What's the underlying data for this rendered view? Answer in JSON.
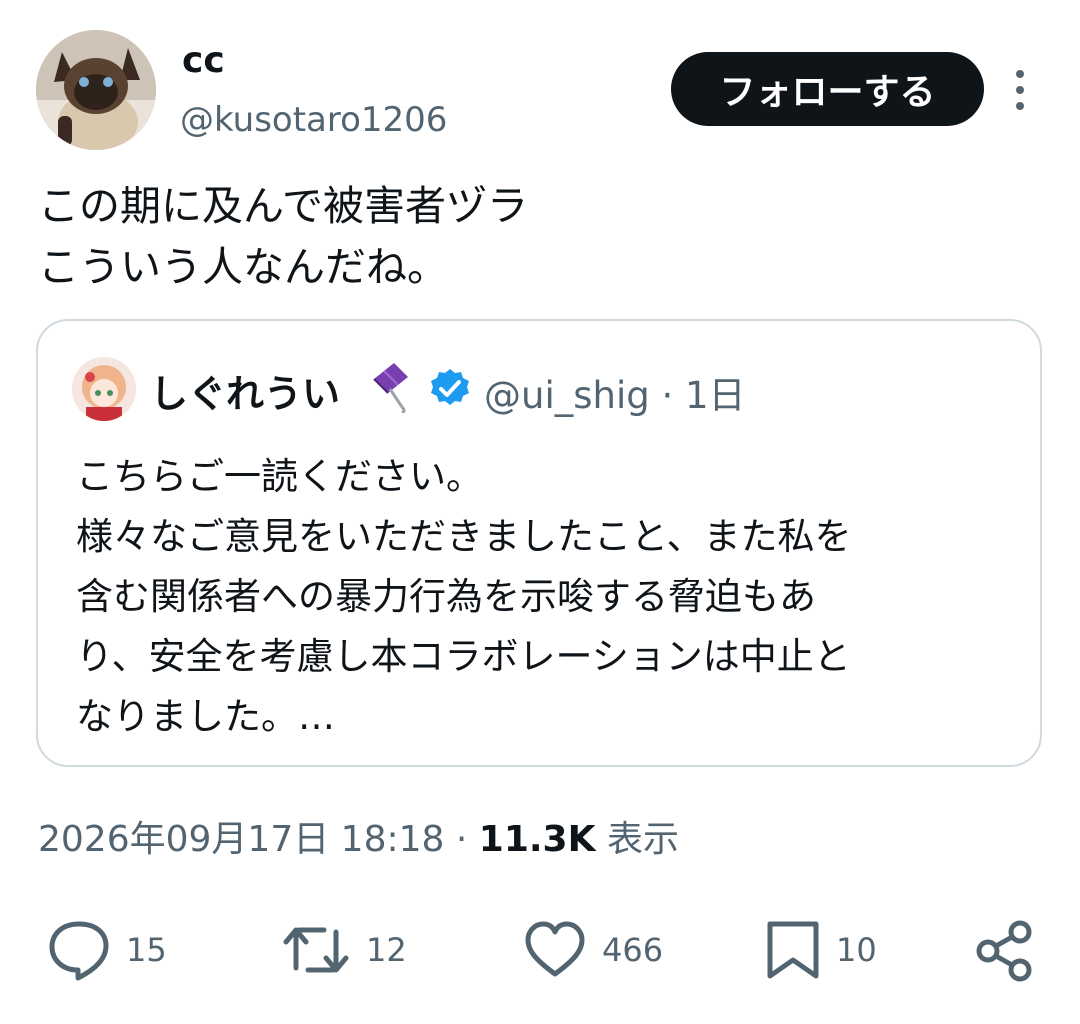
{
  "author": {
    "display_name": "cc",
    "handle": "@kusotaro1206"
  },
  "follow_button": {
    "label": "フォローする"
  },
  "tweet": {
    "text": "この期に及んで被害者ヅラ\nこういう人なんだね。"
  },
  "quoted_tweet": {
    "display_name": "しぐれうい",
    "handle_time": "@ui_shig · 1日",
    "text": "こちらご一読ください。\n様々なご意見をいただきましたこと、また私を\n含む関係者への暴力行為を示唆する脅迫もあ\nり、安全を考慮し本コラボレーションは中止と\nなりました。…",
    "verified": true
  },
  "meta": {
    "timestamp": "2026年09月17日 18:18",
    "separator": " · ",
    "views_count": "11.3K",
    "views_label": " 表示"
  },
  "actions": [
    {
      "icon": "reply-icon",
      "count": "15"
    },
    {
      "icon": "retweet-icon",
      "count": "12"
    },
    {
      "icon": "like-icon",
      "count": "466"
    },
    {
      "icon": "bookmark-icon",
      "count": "10"
    },
    {
      "icon": "share-icon",
      "count": ""
    }
  ],
  "colors": {
    "text_primary": "#0f1419",
    "text_secondary": "#536471",
    "border": "#cfd9de",
    "verified_blue": "#1d9bf0",
    "button_bg": "#0f1419"
  }
}
